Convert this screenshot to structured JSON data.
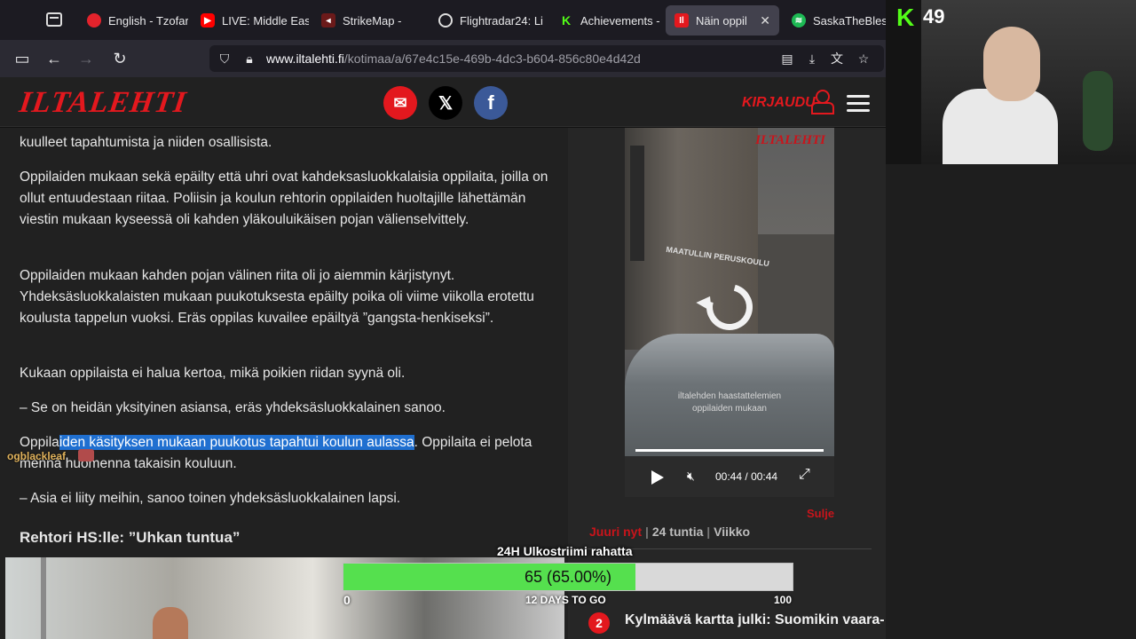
{
  "browser": {
    "tabs": [
      {
        "label": "English - Tzofar",
        "color": "#e3232c",
        "glyph": "●"
      },
      {
        "label": "LIVE: Middle Eas",
        "color": "#ff0000",
        "glyph": "▶"
      },
      {
        "label": "StrikeMap -",
        "color": "#cc2222",
        "glyph": "◂"
      },
      {
        "label": "Flightradar24: Li",
        "color": "#777777",
        "glyph": "◯"
      },
      {
        "label": "Achievements -",
        "color": "#53fc18",
        "glyph": "K"
      },
      {
        "label": "Näin oppilaat",
        "color": "#e3181e",
        "glyph": "I"
      },
      {
        "label": "SaskaTheBlesse",
        "color": "#1db954",
        "glyph": "≋"
      }
    ],
    "url_host": "www.iltalehti.fi",
    "url_path": "/kotimaa/a/67e4c15e-469b-4dc3-b604-856c80e4d42d"
  },
  "site": {
    "logo": "ILTALEHTI",
    "login": "KIRJAUDU",
    "social": [
      {
        "name": "email",
        "color": "#e3181e",
        "glyph": "✉"
      },
      {
        "name": "x",
        "color": "#000000",
        "glyph": "𝕏"
      },
      {
        "name": "facebook",
        "color": "#3b5998",
        "glyph": "f"
      }
    ]
  },
  "article": {
    "p0": "kuulleet tapahtumista ja niiden osallisista.",
    "p1": "Oppilaiden mukaan sekä epäilty että uhri ovat kahdeksasluokkalaisia oppilaita, joilla on ollut entuudestaan riitaa. Poliisin ja koulun rehtorin oppilaiden huoltajille lähettämän viestin mukaan kyseessä oli kahden yläkouluikäisen pojan välienselvittely.",
    "p2": "Oppilaiden mukaan kahden pojan välinen riita oli jo aiemmin kärjistynyt. Yhdeksäsluokkalaisten mukaan puukotuksesta epäilty poika oli viime viikolla erotettu koulusta tappelun vuoksi. Eräs oppilas kuvailee epäiltyä ”gangsta-henkiseksi”.",
    "p3": "Kukaan oppilaista ei halua kertoa, mikä poikien riidan syynä oli.",
    "p4": "– Se on heidän yksityinen asiansa, eräs yhdeksäsluokkalainen sanoo.",
    "p5_pre": "Oppila",
    "p5_sel": "iden käsityksen mukaan puukotus tapahtui koulun aulassa",
    "p5_post": ". Oppilaita ei pelota mennä huomenna takaisin kouluun.",
    "p6": "– Asia ei liity meihin, sanoo toinen yhdeksäsluokkalainen lapsi.",
    "h_rehtori": "Rehtori HS:lle: ”Uhkan tuntua”"
  },
  "video": {
    "watermark": "ILTALEHTI",
    "sign": "MAATULLIN PERUSKOULU",
    "caption_line1": "iltalehden haastattelemien",
    "caption_line2": "oppilaiden mukaan",
    "time_current": "00:44",
    "time_sep": "/",
    "time_total": "00:44",
    "close": "Sulje"
  },
  "sidebar": {
    "tab_now": "Juuri nyt",
    "tab_24h": "24 tuntia",
    "tab_week": "Viikko",
    "news_num": "2",
    "news_title": "Kylmäävä kartta julki: Suomikin vaara-"
  },
  "stream": {
    "viewer_name": "ogblackleaf",
    "viewer_count": "49",
    "goal_title": "24H Ulkostriimi rahatta",
    "goal_value": 65,
    "goal_text": "65 (65.00%)",
    "goal_min": "0",
    "goal_max": "100",
    "goal_days": "12 DAYS TO GO"
  }
}
